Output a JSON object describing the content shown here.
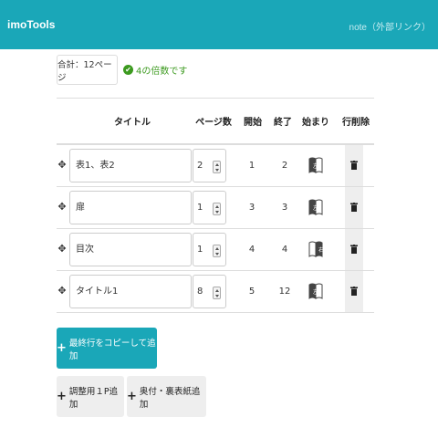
{
  "navbar": {
    "brand": "imoTools",
    "link": "note（外部リンク）"
  },
  "summary": {
    "total": "合計：12ページ",
    "status": "4の倍数です"
  },
  "table": {
    "headers": {
      "title": "タイトル",
      "pages": "ページ数",
      "start": "開始",
      "end": "終了",
      "opening": "始まり",
      "delete": "行削除"
    },
    "rows": [
      {
        "title": "表1、表2",
        "pages": "2",
        "start": "1",
        "end": "2",
        "opening": "left"
      },
      {
        "title": "扉",
        "pages": "1",
        "start": "3",
        "end": "3",
        "opening": "left"
      },
      {
        "title": "目次",
        "pages": "1",
        "start": "4",
        "end": "4",
        "opening": "right"
      },
      {
        "title": "タイトル1",
        "pages": "8",
        "start": "5",
        "end": "12",
        "opening": "left"
      }
    ],
    "book_labels": {
      "left": "左",
      "right": "右"
    }
  },
  "buttons": {
    "copy_last": "最終行をコピーして追加",
    "add_adjust": "調整用１P追加",
    "add_colophon": "奥付・裏表紙追加"
  },
  "colors": {
    "accent": "#1aa7b8",
    "success": "#3c9a1f"
  }
}
